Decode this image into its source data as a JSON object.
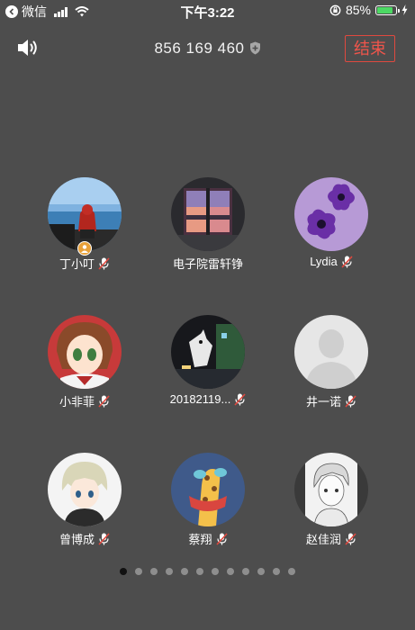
{
  "status_bar": {
    "back_app": "微信",
    "time": "下午3:22",
    "battery": "85%",
    "battery_level": 0.85
  },
  "header": {
    "room_number": "856 169 460",
    "end_label": "结束"
  },
  "participants": [
    {
      "name": "丁小叮",
      "muted": true,
      "host": true,
      "avatar": "photo-person-at-sea"
    },
    {
      "name": "电子院雷轩铮",
      "muted": false,
      "host": false,
      "avatar": "sunset-window"
    },
    {
      "name": "Lydia",
      "muted": true,
      "host": false,
      "avatar": "purple-flowers"
    },
    {
      "name": "小非菲",
      "muted": true,
      "host": false,
      "avatar": "anime-girl"
    },
    {
      "name": "20182119...",
      "muted": true,
      "host": false,
      "avatar": "dark-art"
    },
    {
      "name": "井一诺",
      "muted": true,
      "host": false,
      "avatar": "default-avatar"
    },
    {
      "name": "曾博成",
      "muted": true,
      "host": false,
      "avatar": "anime-boy"
    },
    {
      "name": "蔡翔",
      "muted": true,
      "host": false,
      "avatar": "giraffe-cartoon"
    },
    {
      "name": "赵佳润",
      "muted": true,
      "host": false,
      "avatar": "sketch-boy"
    }
  ],
  "pagination": {
    "total": 12,
    "current": 1
  },
  "colors": {
    "background": "#4d4d4d",
    "end_button": "#e0493f",
    "mute": "#e0493f",
    "battery_fill": "#4cd964"
  }
}
